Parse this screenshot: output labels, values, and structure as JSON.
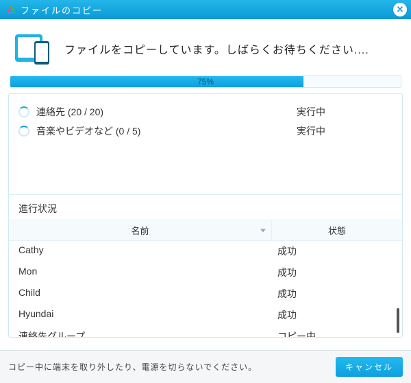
{
  "window": {
    "title": "ファイルのコピー"
  },
  "heading": "ファイルをコピーしています。しばらくお待ちください....",
  "progress": {
    "percent": 75,
    "label": "75%"
  },
  "tasks": [
    {
      "name": "連絡先 (20 / 20)",
      "status": "実行中"
    },
    {
      "name": "音楽やビデオなど (0 / 5)",
      "status": "実行中"
    }
  ],
  "section_title": "進行状況",
  "columns": {
    "name": "名前",
    "status": "状態"
  },
  "rows": [
    {
      "name": "Cathy",
      "status": "成功"
    },
    {
      "name": "Mon",
      "status": "成功"
    },
    {
      "name": "Child",
      "status": "成功"
    },
    {
      "name": "Hyundai",
      "status": "成功"
    },
    {
      "name": "連絡先グループ",
      "status": "コピー中"
    }
  ],
  "footer": {
    "message": "コピー中に端末を取り外したり、電源を切らないでください。",
    "cancel": "キャンセル"
  }
}
